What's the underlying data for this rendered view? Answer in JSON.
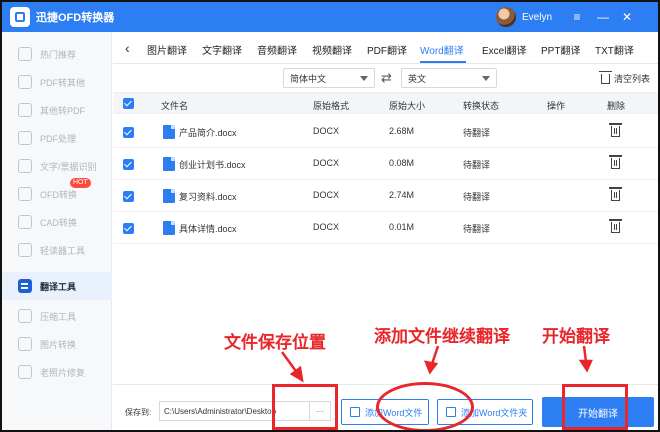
{
  "app": {
    "title": "迅捷OFD转换器",
    "user": "Evelyn"
  },
  "window_controls": {
    "menu": "≡",
    "minimize": "—",
    "close": "✕"
  },
  "sidebar": {
    "items": [
      {
        "label": "热门推荐",
        "icon": "thumbs-up-icon"
      },
      {
        "label": "PDF转其他",
        "icon": "pdf-convert-icon"
      },
      {
        "label": "其他转PDF",
        "icon": "to-pdf-icon"
      },
      {
        "label": "PDF处理",
        "icon": "pdf-process-icon"
      },
      {
        "label": "文字/票据识别",
        "icon": "ocr-icon"
      },
      {
        "label": "OFD转换",
        "icon": "ofd-icon",
        "badge": "HOT"
      },
      {
        "label": "CAD转换",
        "icon": "cad-icon"
      },
      {
        "label": "轻读器工具",
        "icon": "reader-icon"
      },
      {
        "label": "翻译工具",
        "icon": "translate-icon",
        "active": true
      },
      {
        "label": "压缩工具",
        "icon": "compress-icon"
      },
      {
        "label": "图片转换",
        "icon": "image-icon"
      },
      {
        "label": "老照片修复",
        "icon": "photo-restore-icon"
      }
    ]
  },
  "tabs": [
    {
      "label": "图片翻译"
    },
    {
      "label": "文字翻译"
    },
    {
      "label": "音频翻译"
    },
    {
      "label": "视频翻译"
    },
    {
      "label": "PDF翻译"
    },
    {
      "label": "Word翻译",
      "active": true
    },
    {
      "label": "Excel翻译"
    },
    {
      "label": "PPT翻译"
    },
    {
      "label": "TXT翻译"
    }
  ],
  "language": {
    "source": "简体中文",
    "target": "英文",
    "clear_list": "清空列表"
  },
  "table": {
    "headers": {
      "name": "文件名",
      "format": "原始格式",
      "size": "原始大小",
      "status": "转换状态",
      "action": "操作",
      "delete": "删除"
    },
    "rows": [
      {
        "name": "产品简介.docx",
        "format": "DOCX",
        "size": "2.68M",
        "status": "待翻译"
      },
      {
        "name": "创业计划书.docx",
        "format": "DOCX",
        "size": "0.08M",
        "status": "待翻译"
      },
      {
        "name": "复习资料.docx",
        "format": "DOCX",
        "size": "2.74M",
        "status": "待翻译"
      },
      {
        "name": "具体详情.docx",
        "format": "DOCX",
        "size": "0.01M",
        "status": "待翻译"
      }
    ]
  },
  "bottom": {
    "save_label": "保存到:",
    "save_path": "C:\\Users\\Administrator\\Desktop",
    "browse": "···",
    "add_word": "添加Word文件",
    "add_folder": "添加Word文件夹",
    "start": "开始翻译"
  },
  "annotations": {
    "save_location": "文件保存位置",
    "add_continue": "添加文件继续翻译",
    "start_translate": "开始翻译"
  },
  "colors": {
    "accent": "#2d7ef2",
    "annotation": "#e8262b"
  }
}
